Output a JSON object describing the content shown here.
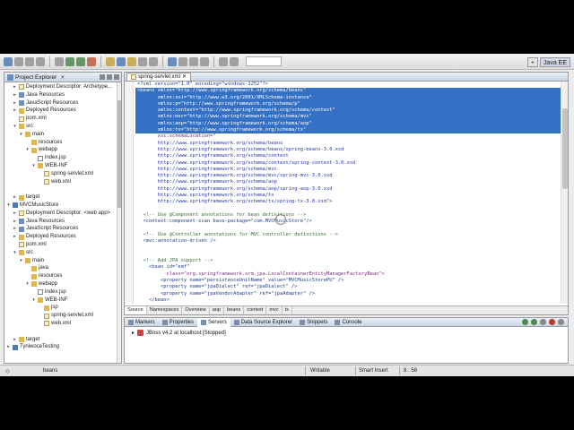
{
  "toolbar": {
    "perspectives": [
      {
        "label": "Java EE",
        "active": true
      }
    ]
  },
  "explorer": {
    "title": "Project Explorer",
    "tree": [
      {
        "label": "Deployment Descriptor: Archetype...",
        "icon": "descriptor",
        "indent": 1,
        "twisty": ">"
      },
      {
        "label": "Java Resources",
        "icon": "pkg",
        "indent": 1,
        "twisty": ">"
      },
      {
        "label": "JavaScript Resources",
        "icon": "pkg",
        "indent": 1,
        "twisty": ">"
      },
      {
        "label": "Deployed Resources",
        "icon": "folder",
        "indent": 1,
        "twisty": ">"
      },
      {
        "label": "pom.xml",
        "icon": "xml",
        "indent": 1,
        "twisty": ""
      },
      {
        "label": "src",
        "icon": "folder",
        "indent": 1,
        "twisty": "v"
      },
      {
        "label": "main",
        "icon": "folder",
        "indent": 2,
        "twisty": "v"
      },
      {
        "label": "resources",
        "icon": "folder",
        "indent": 3,
        "twisty": ""
      },
      {
        "label": "webapp",
        "icon": "folder",
        "indent": 3,
        "twisty": "v"
      },
      {
        "label": "index.jsp",
        "icon": "file",
        "indent": 4,
        "twisty": ""
      },
      {
        "label": "WEB-INF",
        "icon": "folder",
        "indent": 4,
        "twisty": "v"
      },
      {
        "label": "spring-servlet.xml",
        "icon": "xml",
        "indent": 5,
        "twisty": ""
      },
      {
        "label": "web.xml",
        "icon": "xml",
        "indent": 5,
        "twisty": ""
      },
      {
        "label": "",
        "icon": "",
        "indent": 0,
        "twisty": ""
      },
      {
        "label": "target",
        "icon": "folder",
        "indent": 1,
        "twisty": ">"
      },
      {
        "label": "MVCMusicStore",
        "icon": "proj",
        "indent": 0,
        "twisty": "v"
      },
      {
        "label": "Deployment Descriptor: <web app>",
        "icon": "descriptor",
        "indent": 1,
        "twisty": ">"
      },
      {
        "label": "Java Resources",
        "icon": "pkg",
        "indent": 1,
        "twisty": ">"
      },
      {
        "label": "JavaScript Resources",
        "icon": "pkg",
        "indent": 1,
        "twisty": ">"
      },
      {
        "label": "Deployed Resources",
        "icon": "folder",
        "indent": 1,
        "twisty": ">"
      },
      {
        "label": "pom.xml",
        "icon": "xml",
        "indent": 1,
        "twisty": ""
      },
      {
        "label": "src",
        "icon": "folder",
        "indent": 1,
        "twisty": "v"
      },
      {
        "label": "main",
        "icon": "folder",
        "indent": 2,
        "twisty": "v"
      },
      {
        "label": "java",
        "icon": "folder",
        "indent": 3,
        "twisty": ""
      },
      {
        "label": "resources",
        "icon": "folder",
        "indent": 3,
        "twisty": ""
      },
      {
        "label": "webapp",
        "icon": "folder",
        "indent": 3,
        "twisty": "v"
      },
      {
        "label": "index.jsp",
        "icon": "file",
        "indent": 4,
        "twisty": ""
      },
      {
        "label": "WEB-INF",
        "icon": "folder",
        "indent": 4,
        "twisty": "v"
      },
      {
        "label": "jsp",
        "icon": "folder",
        "indent": 5,
        "twisty": ""
      },
      {
        "label": "spring-servlet.xml",
        "icon": "xml",
        "indent": 5,
        "twisty": ""
      },
      {
        "label": "web.xml",
        "icon": "xml",
        "indent": 5,
        "twisty": ""
      },
      {
        "label": "",
        "icon": "",
        "indent": 0,
        "twisty": ""
      },
      {
        "label": "target",
        "icon": "folder",
        "indent": 1,
        "twisty": ">"
      },
      {
        "label": "TyniwoceTesting",
        "icon": "proj",
        "indent": 0,
        "twisty": ">"
      }
    ]
  },
  "editor": {
    "tab_label": "spring-servlet.xml",
    "lines": [
      {
        "text": "<?xml version=\"1.0\" encoding=\"windows-1252\"?>",
        "style": "tag"
      },
      {
        "text": "<beans xmlns=\"http://www.springframework.org/schema/beans\"",
        "style": "sel"
      },
      {
        "text": "       xmlns:xsi=\"http://www.w3.org/2001/XMLSchema-instance\"",
        "style": "sel"
      },
      {
        "text": "       xmlns:p=\"http://www.springframework.org/schema/p\"",
        "style": "sel"
      },
      {
        "text": "       xmlns:context=\"http://www.springframework.org/schema/context\"",
        "style": "sel"
      },
      {
        "text": "       xmlns:mvc=\"http://www.springframework.org/schema/mvc\"",
        "style": "sel"
      },
      {
        "text": "       xmlns:aop=\"http://www.springframework.org/schema/aop\"",
        "style": "sel"
      },
      {
        "text": "       xmlns:tx=\"http://www.springframework.org/schema/tx\"",
        "style": "sel"
      },
      {
        "text": "       xsi:schemaLocation=\"",
        "style": "attr"
      },
      {
        "text": "       http://www.springframework.org/schema/beans",
        "style": "link"
      },
      {
        "text": "       http://www.springframework.org/schema/beans/spring-beans-3.0.xsd",
        "style": "link"
      },
      {
        "text": "       http://www.springframework.org/schema/context",
        "style": "link"
      },
      {
        "text": "       http://www.springframework.org/schema/context/spring-context-3.0.xsd",
        "style": "link"
      },
      {
        "text": "       http://www.springframework.org/schema/mvc",
        "style": "link"
      },
      {
        "text": "       http://www.springframework.org/schema/mvc/spring-mvc-3.0.xsd",
        "style": "link"
      },
      {
        "text": "       http://www.springframework.org/schema/aop",
        "style": "link"
      },
      {
        "text": "       http://www.springframework.org/schema/aop/spring-aop-3.0.xsd",
        "style": "link"
      },
      {
        "text": "       http://www.springframework.org/schema/tx",
        "style": "link"
      },
      {
        "text": "       http://www.springframework.org/schema/tx/spring-tx-3.0.xsd\">",
        "style": "link"
      },
      {
        "text": "",
        "style": "plain"
      },
      {
        "text": "  <!-- Use @Component annotations for bean definitions -->",
        "style": "comment"
      },
      {
        "text": "  <context:component-scan base-package=\"com.MVCMusicStore\"/>",
        "style": "tag"
      },
      {
        "text": "",
        "style": "plain"
      },
      {
        "text": "  <!-- Use @Controller annotations for MVC controller definitions -->",
        "style": "comment"
      },
      {
        "text": "  <mvc:annotation-driven />",
        "style": "tag"
      },
      {
        "text": "",
        "style": "plain"
      },
      {
        "text": "",
        "style": "plain"
      },
      {
        "text": "  <!-- Add JPA support -->",
        "style": "comment"
      },
      {
        "text": "    <bean id=\"emf\"",
        "style": "tag"
      },
      {
        "text": "          class=\"org.springframework.orm.jpa.LocalContainerEntityManagerFactoryBean\">",
        "style": "attr"
      },
      {
        "text": "        <property name=\"persistenceUnitName\" value=\"MVCMusicStorePU\" />",
        "style": "tag"
      },
      {
        "text": "        <property name=\"jpaDialect\" ref=\"jpaDialect\" />",
        "style": "tag"
      },
      {
        "text": "        <property name=\"jpaVendorAdapter\" ref=\"jpaAdapter\" />",
        "style": "tag"
      },
      {
        "text": "    </bean>",
        "style": "tag"
      }
    ],
    "source_tabs": [
      {
        "label": "Source",
        "active": true
      },
      {
        "label": "Namespaces",
        "active": false
      },
      {
        "label": "Overview",
        "active": false
      },
      {
        "label": "aop",
        "active": false
      },
      {
        "label": "beans",
        "active": false
      },
      {
        "label": "context",
        "active": false
      },
      {
        "label": "mvc",
        "active": false
      },
      {
        "label": "tx",
        "active": false
      }
    ]
  },
  "bottom_panel": {
    "tabs": [
      {
        "label": "Markers",
        "active": false
      },
      {
        "label": "Properties",
        "active": false
      },
      {
        "label": "Servers",
        "active": true
      },
      {
        "label": "Data Source Explorer",
        "active": false
      },
      {
        "label": "Snippets",
        "active": false
      },
      {
        "label": "Console",
        "active": false
      }
    ],
    "server": "JBoss v4.2 at localhost  [Stopped]"
  },
  "statusbar": {
    "selection": "beans",
    "mode": "Writable",
    "insert": "Smart Insert",
    "position": "8 : 58"
  }
}
